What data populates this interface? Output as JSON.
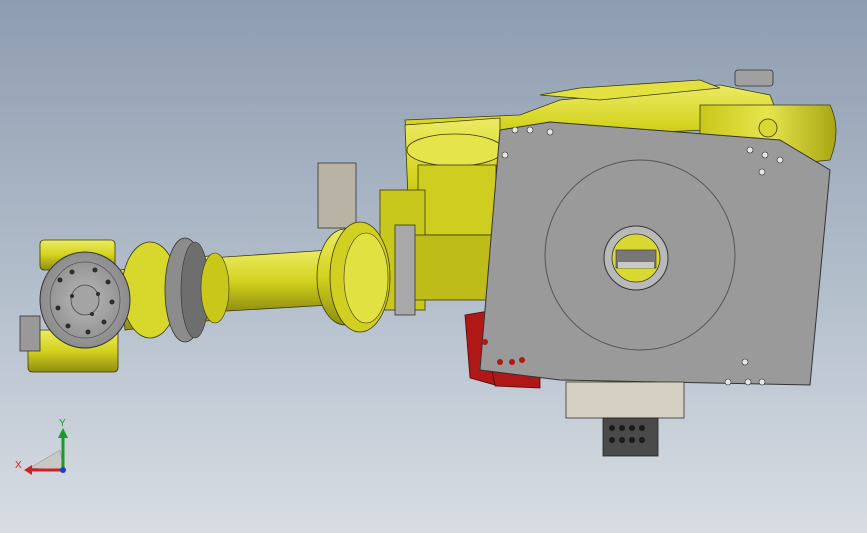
{
  "triad": {
    "x_label": "X",
    "y_label": "Y",
    "x_color": "#d22020",
    "y_color": "#1a9a2a",
    "z_color": "#2040c0"
  },
  "colors": {
    "bg_top": "#8e9db0",
    "bg_bottom": "#d8dde3",
    "robot_yellow": "#d7d62a",
    "robot_yellow_dark": "#8f8d10",
    "plate_gray": "#9a9a9a",
    "plate_gray_dark": "#5e5e5e",
    "accent_red": "#b01818",
    "block_cream": "#d6d0c2",
    "block_dark": "#4a4a4a"
  }
}
